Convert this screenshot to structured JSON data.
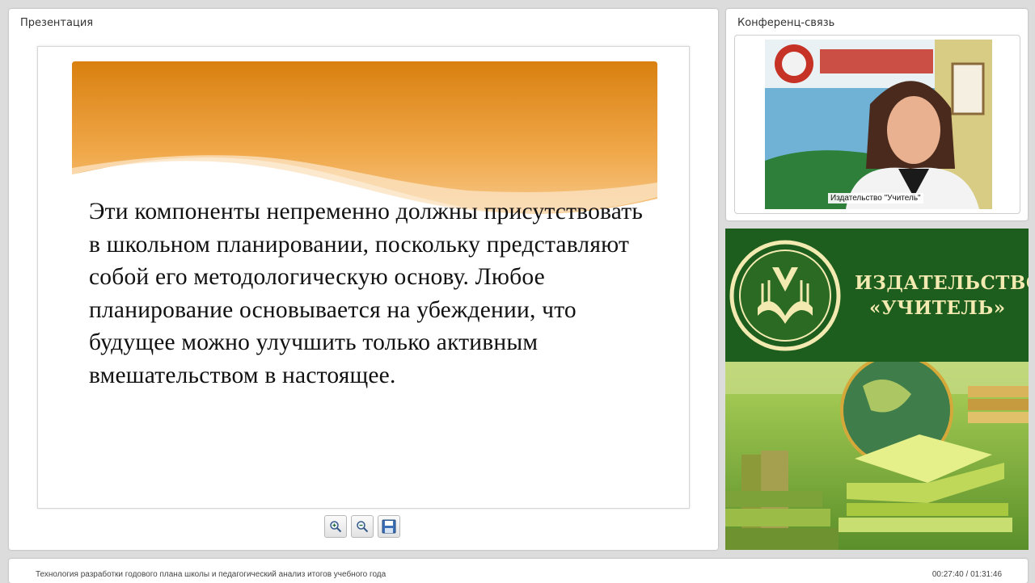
{
  "presentation": {
    "title": "Презентация",
    "slide_text": "Эти компоненты непременно должны присутствовать в школьном планировании, поскольку представляют собой его методологическую основу. Любое планирование основывается на убеждении, что будущее можно улучшить только активным вмешательством в настоящее.",
    "controls": [
      "zoom-in-icon",
      "zoom-out-icon",
      "save-icon"
    ]
  },
  "conference": {
    "title": "Конференц-связь",
    "video_label": "Издательство \"Учитель\""
  },
  "ad": {
    "line1": "ИЗДАТЕЛЬСТВО",
    "line2": "«УЧИТЕЛЬ»"
  },
  "footer": {
    "course_title": "Технология разработки годового плана школы и педагогический анализ итогов учебного года",
    "time": "00:27:40 / 01:31:46"
  },
  "colors": {
    "slide_header": "#e08a1c",
    "ad_green": "#1d5d1d",
    "ad_text": "#f2eab0"
  }
}
